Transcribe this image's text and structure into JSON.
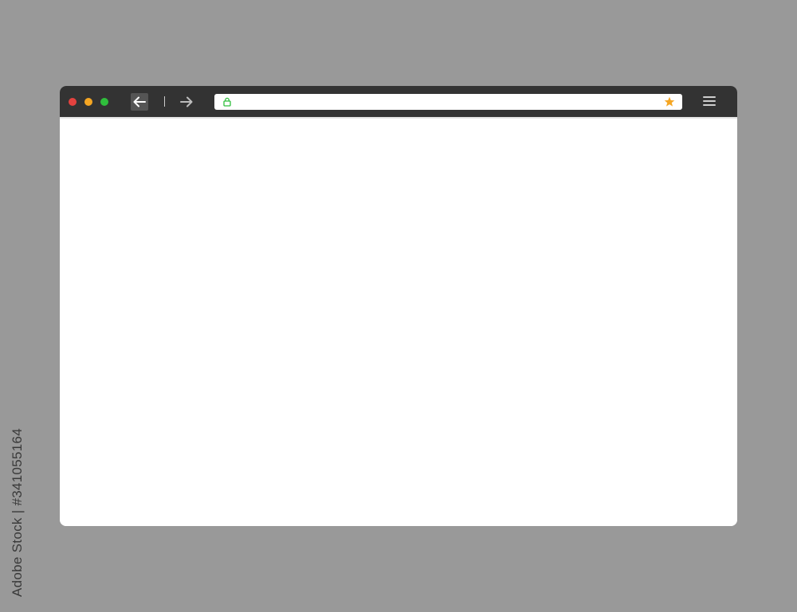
{
  "colors": {
    "backdrop": "#999999",
    "toolbar": "#333333",
    "close_dot": "#e4423f",
    "minimize_dot": "#f5a623",
    "maximize_dot": "#2fbe3c",
    "lock_green": "#2fbe3c",
    "bookmark_star": "#f5a623",
    "page_background": "#ffffff"
  },
  "toolbar": {
    "window_controls": [
      "close-dot",
      "minimize-dot",
      "maximize-dot"
    ],
    "back_icon": "arrow-left-icon",
    "forward_icon": "arrow-right-icon",
    "menu_icon": "hamburger-menu-icon"
  },
  "address_bar": {
    "value": "",
    "secure_icon": "lock-icon",
    "bookmark_icon": "star-icon"
  },
  "watermark": {
    "stock_id": "Adobe Stock | #341055164"
  }
}
